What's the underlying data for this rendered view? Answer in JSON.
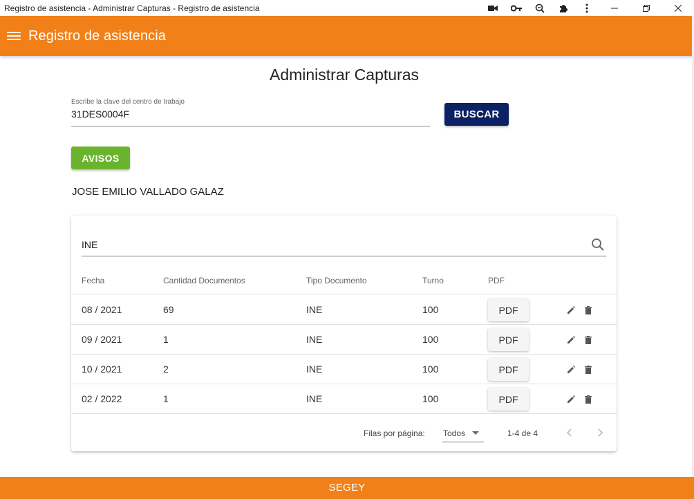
{
  "window": {
    "title": "Registro de asistencia - Administrar Capturas - Registro de asistencia"
  },
  "appbar": {
    "title": "Registro de asistencia"
  },
  "page": {
    "title": "Administrar Capturas",
    "field_label": "Escribe la clave del centro de trabajo",
    "field_value": "31DES0004F",
    "buscar_label": "BUSCAR",
    "avisos_label": "AVISOS",
    "user_name": "JOSE EMILIO VALLADO GALAZ"
  },
  "table": {
    "search_value": "INE",
    "headers": [
      "Fecha",
      "Cantidad Documentos",
      "Tipo Documento",
      "Turno",
      "PDF"
    ],
    "rows": [
      {
        "fecha": "08 / 2021",
        "cantidad": "69",
        "tipo": "INE",
        "turno": "100",
        "pdf": "PDF"
      },
      {
        "fecha": "09 / 2021",
        "cantidad": "1",
        "tipo": "INE",
        "turno": "100",
        "pdf": "PDF"
      },
      {
        "fecha": "10 / 2021",
        "cantidad": "2",
        "tipo": "INE",
        "turno": "100",
        "pdf": "PDF"
      },
      {
        "fecha": "02 / 2022",
        "cantidad": "1",
        "tipo": "INE",
        "turno": "100",
        "pdf": "PDF"
      }
    ],
    "rows_per_page_label": "Filas por página:",
    "rows_per_page_value": "Todos",
    "range_text": "1-4 de 4"
  },
  "footer": {
    "text": "SEGEY"
  },
  "colors": {
    "appbar": "#f28019",
    "buscar": "#0b2163",
    "avisos": "#6ab42d"
  }
}
